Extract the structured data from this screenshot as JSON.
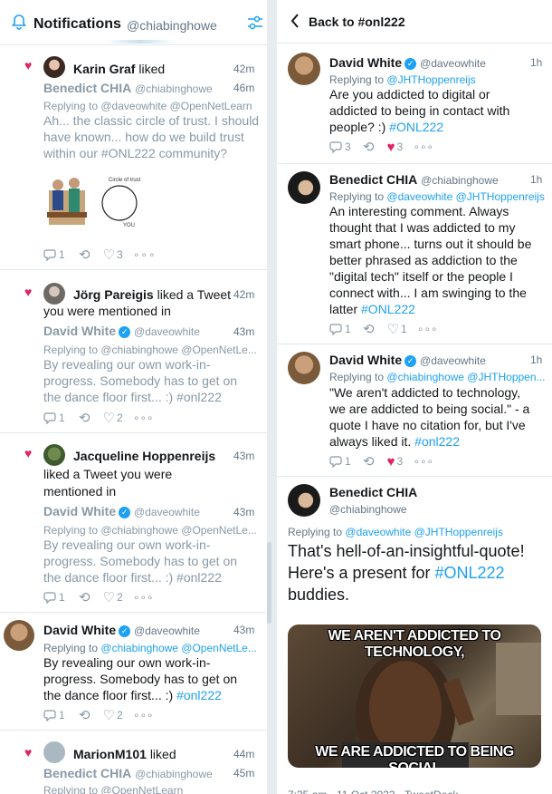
{
  "left": {
    "header": {
      "title": "Notifications",
      "handle": "@chiabinghowe"
    },
    "n1": {
      "actor": "Karin Graf",
      "verb": "liked",
      "time": "42m",
      "tweet_name": "Benedict CHIA",
      "tweet_handle": "@chiabinghowe",
      "tweet_time": "46m",
      "replying": "Replying to @daveowhite @OpenNetLearn",
      "lines": [
        "Ah... the classic circle of trust. I should",
        "have known... how do we build trust",
        "within our #ONL222 community?"
      ],
      "reply": "1",
      "rt": "",
      "like": "3",
      "img_text": "Circle of trust",
      "img_you": "YOU"
    },
    "n2": {
      "actor": "Jörg Pareigis",
      "verb": "liked a Tweet",
      "time": "42m",
      "cont": "you were mentioned in",
      "tweet_name": "David White",
      "tweet_handle": "@daveowhite",
      "tweet_time": "43m",
      "replying": "Replying to @chiabinghowe @OpenNetLe...",
      "lines": [
        "By revealing our own work-in-",
        "progress. Somebody has to get on",
        "the dance floor first... :) #onl222"
      ],
      "reply": "1",
      "like": "2"
    },
    "n3": {
      "actor": "Jacqueline Hoppenreijs",
      "time": "43m",
      "l2": "liked a Tweet you were",
      "l3": "mentioned in",
      "tweet_name": "David White",
      "tweet_handle": "@daveowhite",
      "tweet_time": "43m",
      "replying": "Replying to @chiabinghowe @OpenNetLe...",
      "lines": [
        "By revealing our own work-in-",
        "progress. Somebody has to get on",
        "the dance floor first... :) #onl222"
      ],
      "reply": "1",
      "like": "2"
    },
    "n4": {
      "tweet_name": "David White",
      "tweet_handle": "@daveowhite",
      "tweet_time": "43m",
      "replying_prefix": "Replying to",
      "replying_links": "@chiabinghowe @OpenNetLe...",
      "lines": [
        "By revealing our own work-in-",
        "progress. Somebody has to get on",
        "the dance floor first... :) "
      ],
      "hashtag": "#onl222",
      "reply": "1",
      "like": "2"
    },
    "n5": {
      "actor": "MarionM101",
      "verb": "liked",
      "time": "44m",
      "tweet_name": "Benedict CHIA",
      "tweet_handle": "@chiabinghowe",
      "tweet_time": "45m",
      "replying": "Replying to @OpenNetLearn"
    }
  },
  "right": {
    "header": {
      "back": "Back to #onl222"
    },
    "t1": {
      "name": "David White",
      "handle": "@daveowhite",
      "time": "1h",
      "replying_prefix": "Replying to",
      "replying_links": "@JHTHoppenreijs",
      "lines": [
        "Are you addicted to digital or",
        "addicted to being in contact with",
        "people? :) "
      ],
      "hashtag": "#ONL222",
      "reply": "3",
      "rt": "",
      "like": "3"
    },
    "t2": {
      "name": "Benedict CHIA",
      "handle": "@chiabinghowe",
      "time": "1h",
      "replying_prefix": "Replying to",
      "replying_links": "@daveowhite @JHTHoppenreijs",
      "lines": [
        "An interesting comment. Always",
        "thought that I was addicted to my",
        "smart phone... turns out it should be",
        "better phrased as addiction to the",
        "\"digital tech\" itself or the people I",
        "connect with... I am swinging to the",
        "latter "
      ],
      "hashtag": "#ONL222",
      "reply": "1",
      "like": "1"
    },
    "t3": {
      "name": "David White",
      "handle": "@daveowhite",
      "time": "1h",
      "replying_prefix": "Replying to",
      "replying_links": "@chiabinghowe @JHTHoppen...",
      "lines": [
        "\"We aren't addicted to technology,",
        "we are addicted to being social.\" - a",
        "quote I have no citation for, but I've",
        "always liked it. "
      ],
      "hashtag": "#onl222",
      "reply": "1",
      "like": "3"
    },
    "t4": {
      "name": "Benedict CHIA",
      "handle": "@chiabinghowe",
      "replying_prefix": "Replying to",
      "replying_links": "@daveowhite @JHTHoppenreijs",
      "big_lines": [
        "That's hell-of-an-insightful-quote!",
        "Here's a present for ",
        "buddies."
      ],
      "hashtag": "#ONL222",
      "meme_top": "WE AREN'T ADDICTED TO TECHNOLOGY,",
      "meme_bottom": "WE ARE ADDICTED TO BEING SOCIAL",
      "footer": "7:35 am · 11 Oct 2022 · TweetDeck"
    }
  },
  "colors": {
    "accent": "#1da1f2",
    "heart": "#e0245e",
    "muted": "#657786"
  }
}
